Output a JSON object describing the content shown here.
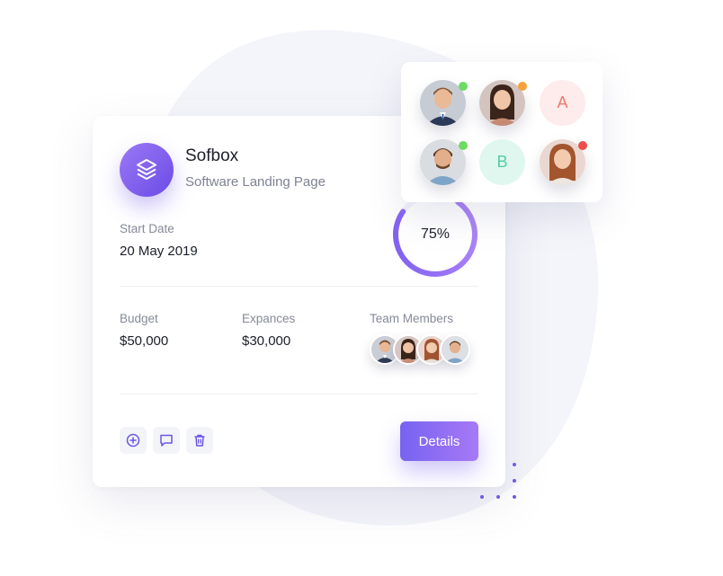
{
  "project": {
    "name": "Sofbox",
    "subtitle": "Software Landing Page",
    "start_date_label": "Start Date",
    "start_date": "20 May 2019",
    "progress_percent": 75,
    "progress_label": "75%",
    "budget_label": "Budget",
    "budget": "$50,000",
    "expenses_label": "Expances",
    "expenses": "$30,000",
    "team_label": "Team Members",
    "team_member_count": 4,
    "details_label": "Details"
  },
  "actions": [
    {
      "name": "add-circle-icon"
    },
    {
      "name": "comment-icon"
    },
    {
      "name": "trash-icon"
    }
  ],
  "team_panel": {
    "members": [
      {
        "type": "photo",
        "status_color": "#6ddb63"
      },
      {
        "type": "photo",
        "status_color": "#f5a23a"
      },
      {
        "type": "letter",
        "letter": "A",
        "bg": "#fdeceb",
        "fg": "#f07a6e"
      },
      {
        "type": "photo",
        "status_color": "#6ddb63"
      },
      {
        "type": "letter",
        "letter": "B",
        "bg": "#dff7ef",
        "fg": "#56cba4"
      },
      {
        "type": "photo",
        "status_color": "#ef4b4b"
      }
    ]
  },
  "colors": {
    "accent": "#7a5cf0",
    "accent_light": "#a779f6",
    "blob": "#f4f5fa"
  }
}
